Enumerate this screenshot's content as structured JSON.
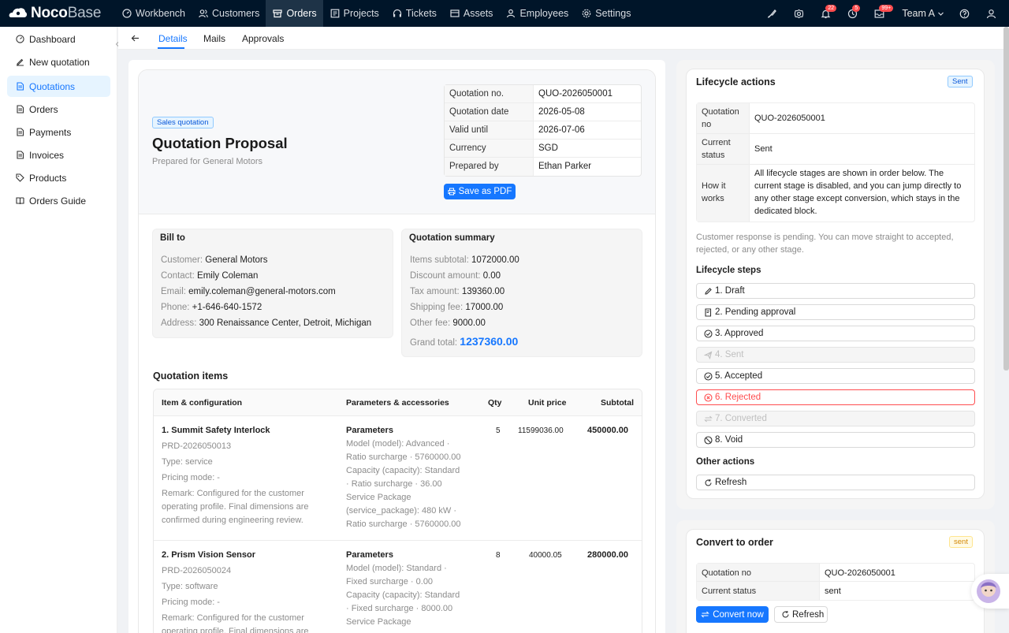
{
  "app": {
    "brand_bold": "Noco",
    "brand_thin": "Base"
  },
  "topnav": [
    {
      "label": "Workbench",
      "icon": "workbench-icon"
    },
    {
      "label": "Customers",
      "icon": "customers-icon"
    },
    {
      "label": "Orders",
      "icon": "orders-icon",
      "active": true
    },
    {
      "label": "Projects",
      "icon": "projects-icon"
    },
    {
      "label": "Tickets",
      "icon": "tickets-icon"
    },
    {
      "label": "Assets",
      "icon": "assets-icon"
    },
    {
      "label": "Employees",
      "icon": "employees-icon"
    },
    {
      "label": "Settings",
      "icon": "settings-icon"
    }
  ],
  "topright": {
    "badge1": "22",
    "badge2": "5",
    "badge3": "99+",
    "team": "Team A"
  },
  "sidebar": [
    {
      "label": "Dashboard",
      "icon": "dashboard-icon"
    },
    {
      "label": "New quotation",
      "icon": "edit-icon"
    },
    {
      "label": "Quotations",
      "icon": "file-icon",
      "active": true
    },
    {
      "label": "Orders",
      "icon": "file-icon"
    },
    {
      "label": "Payments",
      "icon": "file-icon"
    },
    {
      "label": "Invoices",
      "icon": "file-icon"
    },
    {
      "label": "Products",
      "icon": "tag-icon"
    },
    {
      "label": "Orders Guide",
      "icon": "book-icon"
    }
  ],
  "tabs": [
    "Details",
    "Mails",
    "Approvals"
  ],
  "doc": {
    "tag": "Sales quotation",
    "title": "Quotation Proposal",
    "subtitle": "Prepared for General Motors",
    "meta": [
      {
        "k": "Quotation no.",
        "v": "QUO-2026050001"
      },
      {
        "k": "Quotation date",
        "v": "2026-05-08"
      },
      {
        "k": "Valid until",
        "v": "2026-07-06"
      },
      {
        "k": "Currency",
        "v": "SGD"
      },
      {
        "k": "Prepared by",
        "v": "Ethan Parker"
      }
    ],
    "save_pdf": "Save as PDF",
    "bill_to": {
      "title": "Bill to",
      "rows": [
        {
          "k": "Customer",
          "v": "General Motors"
        },
        {
          "k": "Contact",
          "v": "Emily Coleman"
        },
        {
          "k": "Email",
          "v": "emily.coleman@general-motors.com"
        },
        {
          "k": "Phone",
          "v": "+1-646-640-1572"
        },
        {
          "k": "Address",
          "v": "300 Renaissance Center, Detroit, Michigan"
        }
      ]
    },
    "summary": {
      "title": "Quotation summary",
      "rows": [
        {
          "k": "Items subtotal",
          "v": "1072000.00"
        },
        {
          "k": "Discount amount",
          "v": "0.00"
        },
        {
          "k": "Tax amount",
          "v": "139360.00"
        },
        {
          "k": "Shipping fee",
          "v": "17000.00"
        },
        {
          "k": "Other fee",
          "v": "9000.00"
        }
      ],
      "grand_k": "Grand total",
      "grand_v": "1237360.00"
    },
    "items_title": "Quotation items",
    "columns": [
      "Item & configuration",
      "Parameters & accessories",
      "Qty",
      "Unit price",
      "Subtotal"
    ],
    "items": [
      {
        "name": "1. Summit Safety Interlock",
        "code": "PRD-2026050013",
        "type": "Type: service",
        "pricing": "Pricing mode: -",
        "remark1": "Remark: Configured for the customer",
        "remark2": "operating profile. Final dimensions are",
        "remark3": "confirmed during engineering review.",
        "params_title": "Parameters",
        "p1": "Model (model): Advanced ·",
        "p2": "Ratio surcharge · 5760000.00",
        "p3": "Capacity (capacity): Standard",
        "p4": "· Ratio surcharge · 36.00",
        "p5": "Service Package",
        "p6": "(service_package): 480 kW ·",
        "p7": "Ratio surcharge · 5760000.00",
        "qty": "5",
        "unit": "11599036.00",
        "subtotal": "450000.00"
      },
      {
        "name": "2. Prism Vision Sensor",
        "code": "PRD-2026050024",
        "type": "Type: software",
        "pricing": "Pricing mode: -",
        "remark1": "Remark: Configured for the customer",
        "remark2": "operating profile. Final dimensions are",
        "params_title": "Parameters",
        "p1": "Model (model): Standard ·",
        "p2": "Fixed surcharge · 0.00",
        "p3": "Capacity (capacity): Standard",
        "p4": "· Fixed surcharge · 8000.00",
        "p5": "Service Package",
        "qty": "8",
        "unit": "40000.05",
        "subtotal": "280000.00"
      }
    ]
  },
  "lifecycle": {
    "title": "Lifecycle actions",
    "tag": "Sent",
    "info": {
      "qno_k": "Quotation no",
      "qno_v": "QUO-2026050001",
      "status_k": "Current status",
      "status_v": "Sent",
      "how_k": "How it works",
      "how_v": "All lifecycle stages are shown in order below. The current stage is disabled, and you can jump directly to any other stage except conversion, which stays in the dedicated block."
    },
    "note": "Customer response is pending. You can move straight to accepted, rejected, or any other stage.",
    "steps_title": "Lifecycle steps",
    "steps": [
      "1. Draft",
      "2. Pending approval",
      "3. Approved",
      "4. Sent",
      "5. Accepted",
      "6. Rejected",
      "7. Converted",
      "8. Void"
    ],
    "other_title": "Other actions",
    "refresh": "Refresh"
  },
  "convert": {
    "title": "Convert to order",
    "tag": "sent",
    "qno_k": "Quotation no",
    "qno_v": "QUO-2026050001",
    "status_k": "Current status",
    "status_v": "sent",
    "convert_btn": "Convert now",
    "refresh": "Refresh"
  }
}
